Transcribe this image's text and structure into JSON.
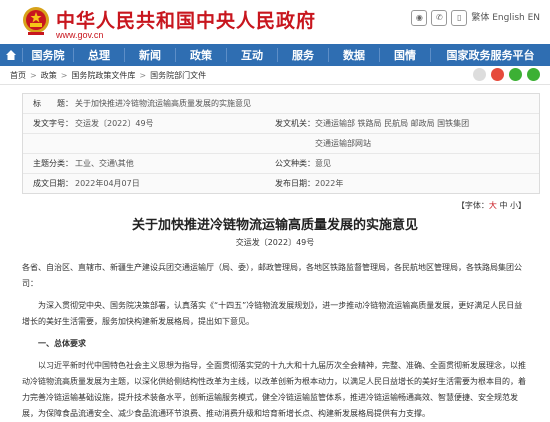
{
  "header": {
    "site_title": "中华人民共和国中央人民政府",
    "site_url": "www.gov.cn",
    "icons": [
      "weibo-icon",
      "wechat-icon",
      "mobile-icon"
    ],
    "lang_links": "繁体 English EN"
  },
  "nav": [
    "国务院",
    "总理",
    "新闻",
    "政策",
    "互动",
    "服务",
    "数据",
    "国情",
    "国家政务服务平台"
  ],
  "breadcrumb": [
    "首页",
    "政策",
    "国务院政策文件库",
    "国务院部门文件"
  ],
  "info": {
    "title_label": "标　　题：",
    "title_value": "关于加快推进冷链物流运输高质量发展的实施意见",
    "docnum_label": "发文字号：",
    "docnum_value": "交运发〔2022〕49号",
    "issuer_label": "发文机关：",
    "issuer_value": "交通运输部 铁路局 民航局 邮政局 国铁集团",
    "issuer2_value": "交通运输部网站",
    "topic_label": "主题分类：",
    "topic_value": "工业、交通\\其他",
    "type_label": "公文种类：",
    "type_value": "意见",
    "written_label": "成文日期：",
    "written_value": "2022年04月07日",
    "published_label": "发布日期：",
    "published_value": "2022年"
  },
  "font_size": {
    "label": "【字体：",
    "large": "大",
    "mid": "中",
    "small": "小",
    "end": "】"
  },
  "doc_title": "关于加快推进冷链物流运输高质量发展的实施意见",
  "doc_number": "交运发〔2022〕49号",
  "paragraphs": {
    "addressees": "各省、自治区、直辖市、新疆生产建设兵团交通运输厅（局、委），邮政管理局，各地区铁路监督管理局，各民航地区管理局，各铁路局集团公司：",
    "p1": "为深入贯彻党中央、国务院决策部署，认真落实《“十四五”冷链物流发展规划》，进一步推动冷链物流运输高质量发展，更好满足人民日益增长的美好生活需要，服务加快构建新发展格局，提出如下意见。",
    "sec1": "一、总体要求",
    "p2": "以习近平新时代中国特色社会主义思想为指导，全面贯彻落实党的十九大和十九届历次全会精神，完整、准确、全面贯彻新发展理念，以推动冷链物流高质量发展为主题，以深化供给侧结构性改革为主线，以改革创新为根本动力，以满足人民日益增长的美好生活需要为根本目的，着力完善冷链运输基础设施，提升技术装备水平，创新运输服务模式，健全冷链运输监管体系，推进冷链运输畅通高效、智慧便捷、安全规范发展，为保障食品流通安全、减少食品流通环节浪费、推动消费升级和培育新增长点、构建新发展格局提供有力支撑。"
  }
}
